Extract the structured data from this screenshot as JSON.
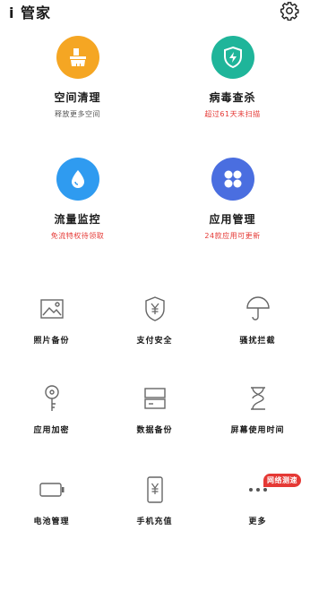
{
  "header": {
    "title": "i 管家"
  },
  "big_items": [
    {
      "label": "空间清理",
      "sub": "释放更多空间",
      "sub_color": "#555555",
      "color": "#f5a623",
      "icon": "broom-icon"
    },
    {
      "label": "病毒查杀",
      "sub": "超过61天未扫描",
      "sub_color": "#e53935",
      "color": "#1fb59a",
      "icon": "shield-bolt-icon"
    },
    {
      "label": "流量监控",
      "sub": "免流特权待领取",
      "sub_color": "#e53935",
      "color": "#2f9bf0",
      "icon": "water-drop-icon"
    },
    {
      "label": "应用管理",
      "sub": "24款应用可更新",
      "sub_color": "#e53935",
      "color": "#4a6ee0",
      "icon": "apps-grid-icon"
    }
  ],
  "small_items": [
    {
      "label": "照片备份",
      "icon": "photo-icon"
    },
    {
      "label": "支付安全",
      "icon": "yuan-shield-icon"
    },
    {
      "label": "骚扰拦截",
      "icon": "umbrella-icon"
    },
    {
      "label": "应用加密",
      "icon": "key-icon"
    },
    {
      "label": "数据备份",
      "icon": "database-icon"
    },
    {
      "label": "屏幕使用时间",
      "icon": "hourglass-icon"
    },
    {
      "label": "电池管理",
      "icon": "battery-icon"
    },
    {
      "label": "手机充值",
      "icon": "phone-yuan-icon"
    },
    {
      "label": "更多",
      "icon": "more-icon"
    }
  ],
  "badge": {
    "text": "网络测速"
  }
}
